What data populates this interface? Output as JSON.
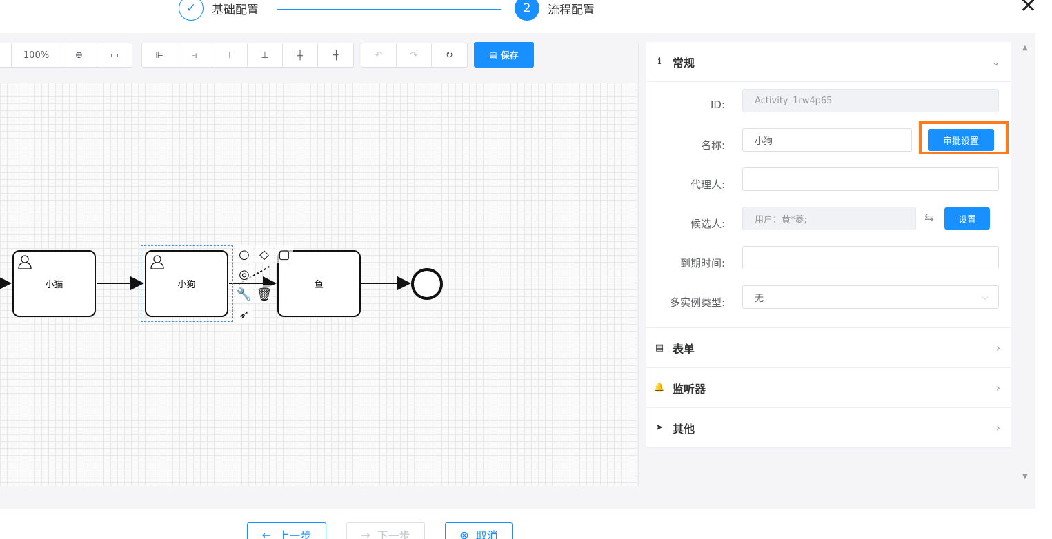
{
  "steps": [
    {
      "label": "基础配置",
      "marker": "✓"
    },
    {
      "label": "流程配置",
      "marker": "2"
    }
  ],
  "toolbar": {
    "zoom_value": "100%",
    "save_label": "保存"
  },
  "diagram": {
    "tasks": [
      {
        "label": "小猫"
      },
      {
        "label": "小狗"
      },
      {
        "label": "鱼"
      }
    ]
  },
  "panel": {
    "general": {
      "title": "常规",
      "id_label": "ID:",
      "id_value": "Activity_1rw4p65",
      "name_label": "名称:",
      "name_value": "小狗",
      "approval_button": "审批设置",
      "assignee_label": "代理人:",
      "assignee_value": "",
      "candidate_label": "候选人:",
      "candidate_value": "用户：黄*菱;",
      "candidate_button": "设置",
      "due_label": "到期时间:",
      "due_value": "",
      "multi_label": "多实例类型:",
      "multi_value": "无"
    },
    "sections": [
      {
        "title": "表单",
        "icon": "form-icon"
      },
      {
        "title": "监听器",
        "icon": "bell-icon"
      },
      {
        "title": "其他",
        "icon": "send-icon"
      }
    ]
  },
  "footer": {
    "prev": "上一步",
    "next": "下一步",
    "cancel": "取消"
  },
  "colors": {
    "primary": "#1890ff",
    "highlight": "#ff7a1a"
  }
}
